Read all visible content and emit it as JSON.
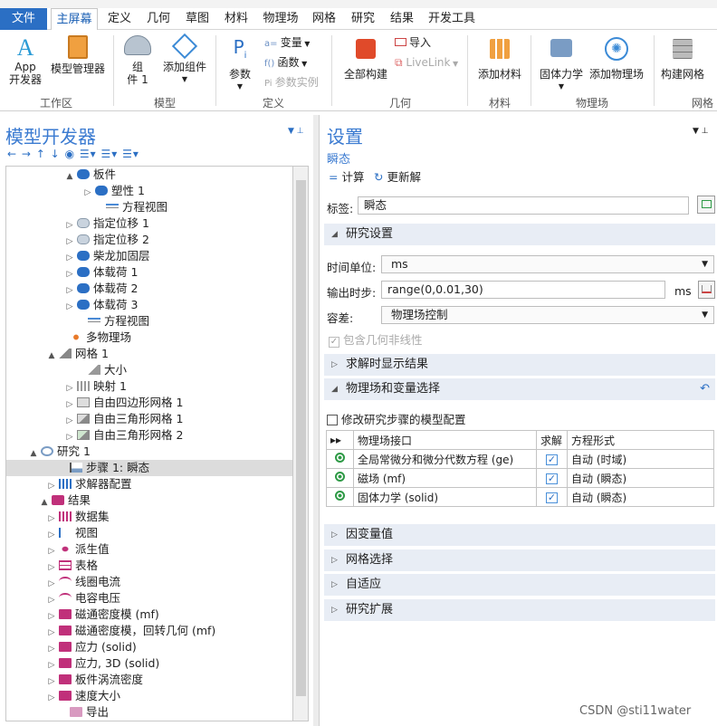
{
  "menu": {
    "tabs": [
      "文件",
      "主屏幕",
      "定义",
      "几何",
      "草图",
      "材料",
      "物理场",
      "网格",
      "研究",
      "结果",
      "开发工具"
    ],
    "active": "主屏幕"
  },
  "ribbon": {
    "app_builder": [
      "App",
      "开发器"
    ],
    "model_manager": "模型管理器",
    "component": [
      "组",
      "件 1"
    ],
    "add_component": "添加组件",
    "param": "参数",
    "variables": "变量",
    "functions": "函数",
    "param_case": "参数实例",
    "build_all": "全部构建",
    "import": "导入",
    "livelink": "LiveLink",
    "add_material": "添加材料",
    "solid_mech": "固体力学",
    "add_physics": "添加物理场",
    "build_mesh": "构建网格",
    "groups": [
      "工作区",
      "模型",
      "定义",
      "几何",
      "材料",
      "物理场",
      "网格"
    ]
  },
  "left_panel": {
    "title": "模型开发器"
  },
  "tree": [
    {
      "label": "板件",
      "arrow": "▲",
      "icon": "blue"
    },
    {
      "label": "塑性 1",
      "arrow": "▷",
      "icon": "blue"
    },
    {
      "label": "方程视图",
      "arrow": "",
      "icon": "eq"
    },
    {
      "label": "指定位移 1",
      "arrow": "▷",
      "icon": "grey"
    },
    {
      "label": "指定位移 2",
      "arrow": "▷",
      "icon": "grey"
    },
    {
      "label": "柴龙加固层",
      "arrow": "▷",
      "icon": "blue"
    },
    {
      "label": "体载荷 1",
      "arrow": "▷",
      "icon": "blue"
    },
    {
      "label": "体载荷 2",
      "arrow": "▷",
      "icon": "blue"
    },
    {
      "label": "体载荷 3",
      "arrow": "▷",
      "icon": "blue"
    },
    {
      "label": "方程视图",
      "arrow": "",
      "icon": "eq"
    },
    {
      "label": "多物理场",
      "arrow": "",
      "icon": "multi"
    },
    {
      "label": "网格 1",
      "arrow": "▲",
      "icon": "mesh"
    },
    {
      "label": "大小",
      "arrow": "",
      "icon": "size"
    },
    {
      "label": "映射 1",
      "arrow": "▷",
      "icon": "map"
    },
    {
      "label": "自由四边形网格 1",
      "arrow": "▷",
      "icon": "quad"
    },
    {
      "label": "自由三角形网格 1",
      "arrow": "▷",
      "icon": "tri"
    },
    {
      "label": "自由三角形网格 2",
      "arrow": "▷",
      "icon": "tri2"
    },
    {
      "label": "研究 1",
      "arrow": "▲",
      "icon": "study"
    },
    {
      "label": "步骤 1: 瞬态",
      "arrow": "",
      "icon": "step"
    },
    {
      "label": "求解器配置",
      "arrow": "▷",
      "icon": "solver"
    },
    {
      "label": "结果",
      "arrow": "▲",
      "icon": "result"
    },
    {
      "label": "数据集",
      "arrow": "▷",
      "icon": "dataset"
    },
    {
      "label": "视图",
      "arrow": "▷",
      "icon": "view"
    },
    {
      "label": "派生值",
      "arrow": "▷",
      "icon": "derived"
    },
    {
      "label": "表格",
      "arrow": "▷",
      "icon": "table"
    },
    {
      "label": "线圈电流",
      "arrow": "▷",
      "icon": "wave"
    },
    {
      "label": "电容电压",
      "arrow": "▷",
      "icon": "wave"
    },
    {
      "label": "磁通密度模 (mf)",
      "arrow": "▷",
      "icon": "plot"
    },
    {
      "label": "磁通密度模，回转几何 (mf)",
      "arrow": "▷",
      "icon": "plot"
    },
    {
      "label": "应力 (solid)",
      "arrow": "▷",
      "icon": "plot"
    },
    {
      "label": "应力, 3D (solid)",
      "arrow": "▷",
      "icon": "plot"
    },
    {
      "label": "板件涡流密度",
      "arrow": "▷",
      "icon": "plot"
    },
    {
      "label": "速度大小",
      "arrow": "▷",
      "icon": "plot"
    },
    {
      "label": "导出",
      "arrow": "",
      "icon": "export"
    }
  ],
  "settings": {
    "title": "设置",
    "subtitle": "瞬态",
    "compute": "计算",
    "update": "更新解",
    "label_caption": "标签:",
    "label_value": "瞬态",
    "sec_study": "研究设置",
    "time_unit_label": "时间单位:",
    "time_unit": "ms",
    "output_label": "输出时步:",
    "output_value": "range(0,0.01,30)",
    "output_unit": "ms",
    "tol_label": "容差:",
    "tol_value": "物理场控制",
    "geom_nonlin": "包含几何非线性",
    "sec_results": "求解时显示结果",
    "sec_physics": "物理场和变量选择",
    "modify_config": "修改研究步骤的模型配置",
    "table_headers": [
      "物理场接口",
      "求解",
      "方程形式"
    ],
    "rows": [
      {
        "iface": "全局常微分和微分代数方程 (ge)",
        "form": "自动 (时域)"
      },
      {
        "iface": "磁场 (mf)",
        "form": "自动 (瞬态)"
      },
      {
        "iface": "固体力学 (solid)",
        "form": "自动 (瞬态)"
      }
    ],
    "sec_dep": "因变量值",
    "sec_mesh": "网格选择",
    "sec_adapt": "自适应",
    "sec_ext": "研究扩展"
  },
  "watermark": "CSDN @sti11water",
  "colors": {
    "accent": "#2b6fc4",
    "title": "#3b7bd1",
    "section": "#e8edf5"
  }
}
